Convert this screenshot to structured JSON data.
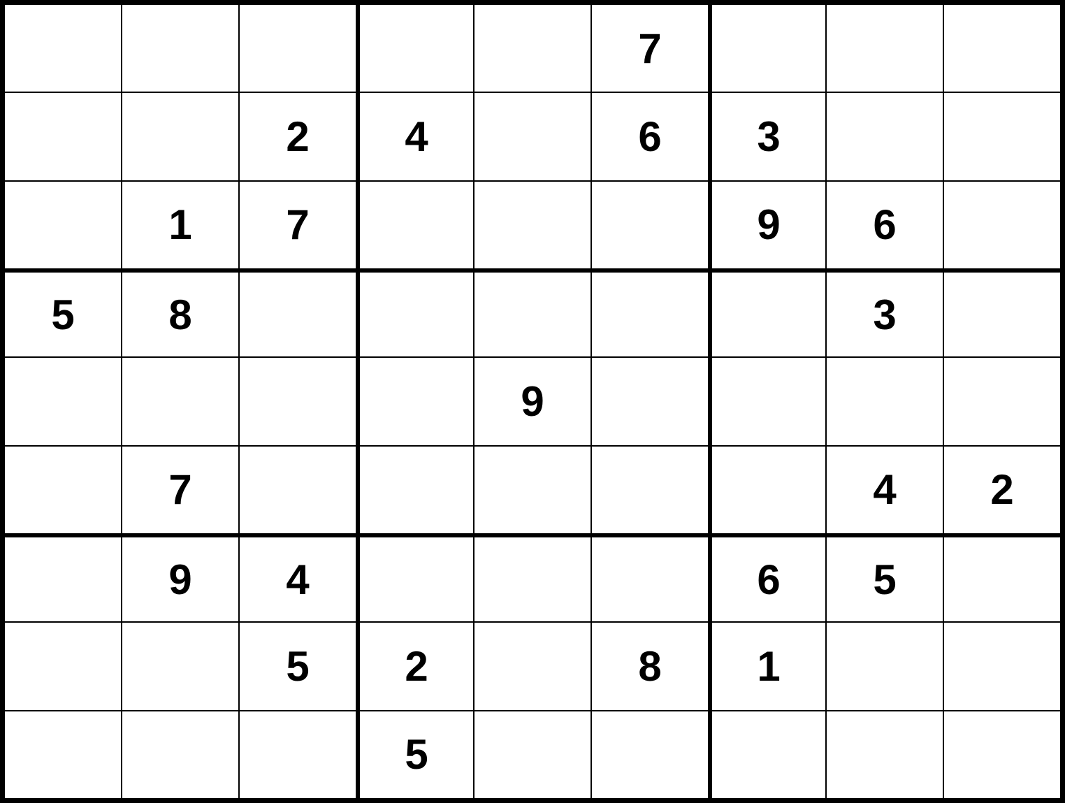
{
  "puzzle": {
    "type": "sudoku",
    "size": 9,
    "grid": [
      [
        "",
        "",
        "",
        "",
        "",
        "7",
        "",
        "",
        ""
      ],
      [
        "",
        "",
        "2",
        "4",
        "",
        "6",
        "3",
        "",
        ""
      ],
      [
        "",
        "1",
        "7",
        "",
        "",
        "",
        "9",
        "6",
        ""
      ],
      [
        "5",
        "8",
        "",
        "",
        "",
        "",
        "",
        "3",
        ""
      ],
      [
        "",
        "",
        "",
        "",
        "9",
        "",
        "",
        "",
        ""
      ],
      [
        "",
        "7",
        "",
        "",
        "",
        "",
        "",
        "4",
        "2"
      ],
      [
        "",
        "9",
        "4",
        "",
        "",
        "",
        "6",
        "5",
        ""
      ],
      [
        "",
        "",
        "5",
        "2",
        "",
        "8",
        "1",
        "",
        ""
      ],
      [
        "",
        "",
        "",
        "5",
        "",
        "",
        "",
        "",
        ""
      ]
    ]
  }
}
